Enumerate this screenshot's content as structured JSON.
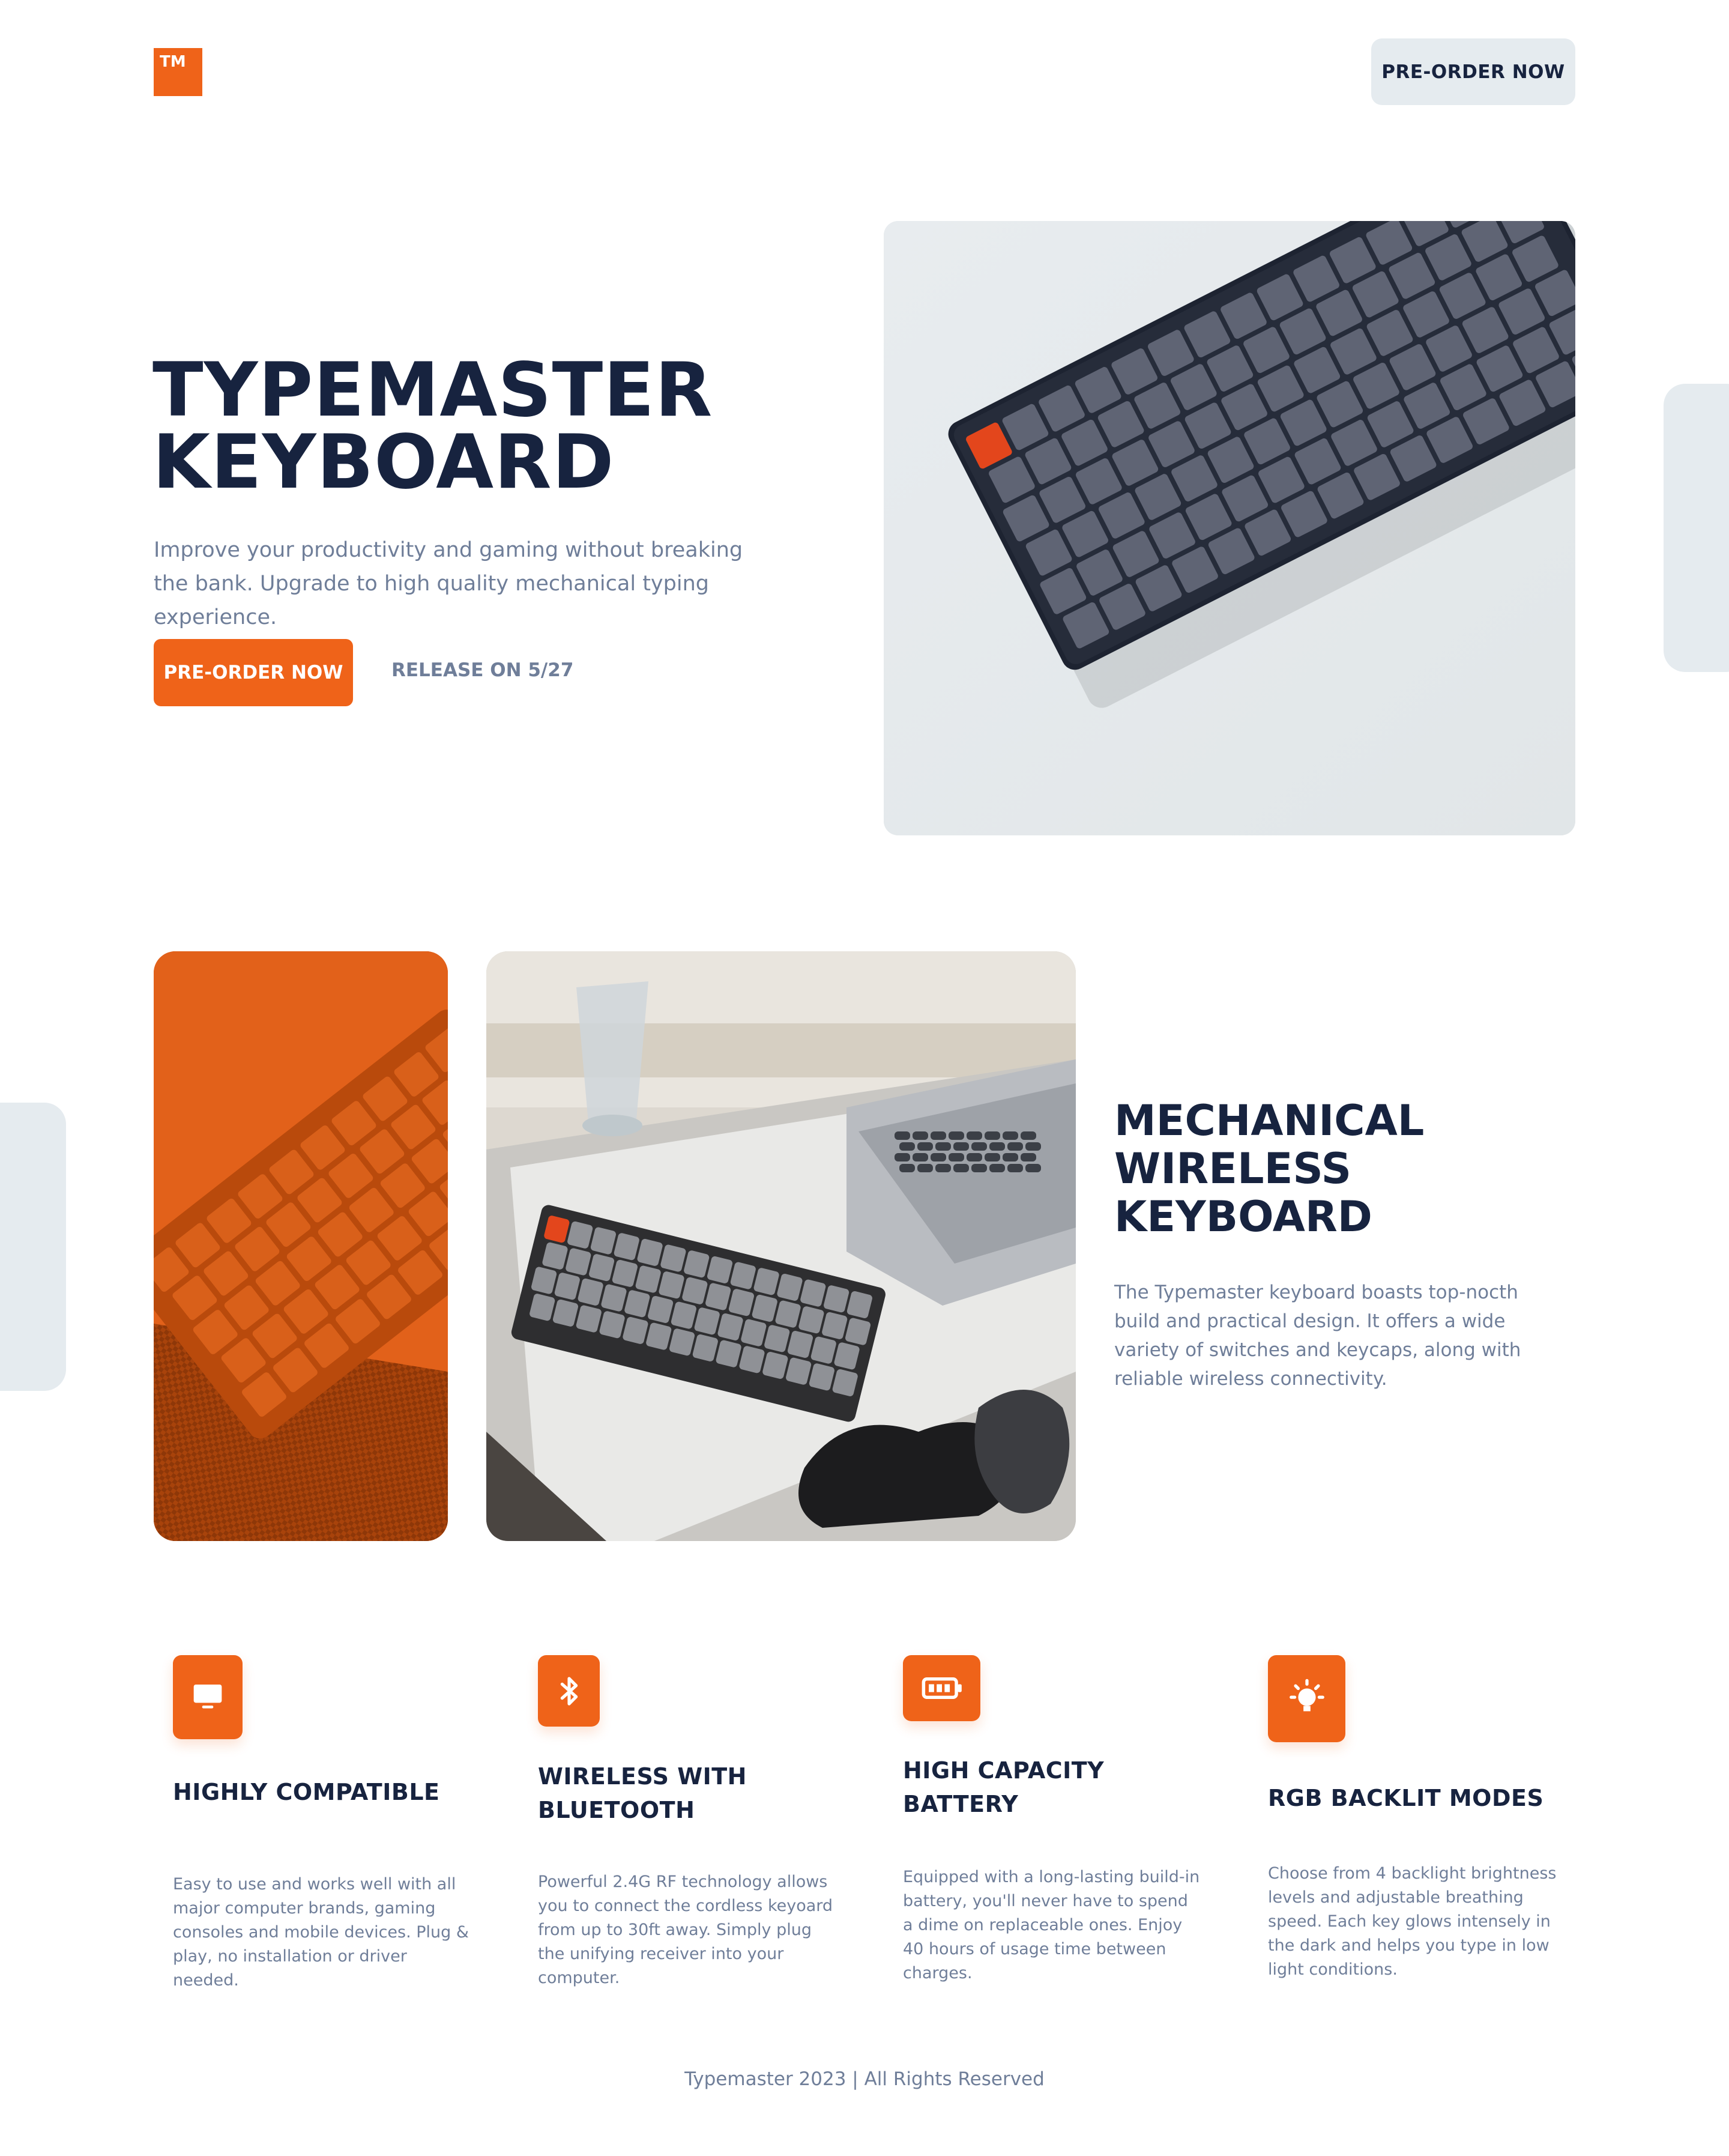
{
  "header": {
    "logo_text": "TM",
    "preorder_label": "PRE-ORDER NOW"
  },
  "hero": {
    "title_line1": "TYPEMASTER",
    "title_line2": "KEYBOARD",
    "subtitle": "Improve your productivity and gaming without breaking the bank. Upgrade to high quality mechanical typing experience.",
    "cta_label": "PRE-ORDER NOW",
    "release_text": "RELEASE ON 5/27"
  },
  "section": {
    "title_line1": "MECHANICAL",
    "title_line2": "WIRELESS",
    "title_line3": "KEYBOARD",
    "description": "The Typemaster keyboard boasts top-nocth build and practical design. It offers a wide variety of switches and keycaps, along with reliable wireless connectivity."
  },
  "features": [
    {
      "icon": "monitor-icon",
      "title": "HIGHLY COMPATIBLE",
      "text": "Easy to use and works well with all major computer brands, gaming consoles and mobile devices. Plug & play, no installation or driver needed."
    },
    {
      "icon": "bluetooth-icon",
      "title": "WIRELESS WITH BLUETOOTH",
      "text": "Powerful 2.4G RF technology allows you to connect the cordless keyoard from up to 30ft away. Simply plug the unifying receiver into your computer."
    },
    {
      "icon": "battery-icon",
      "title": "HIGH CAPACITY BATTERY",
      "text": "Equipped with a long-lasting build-in battery, you'll never have to spend a dime on replaceable ones. Enjoy 40 hours of usage time between charges."
    },
    {
      "icon": "lightbulb-icon",
      "title": "RGB BACKLIT MODES",
      "text": "Choose from 4 backlight brightness levels and adjustable breathing speed. Each key glows intensely in the dark and helps you type in low light conditions."
    }
  ],
  "footer": {
    "text": "Typemaster 2023 | All Rights Reserved"
  },
  "colors": {
    "accent": "#ef6319",
    "heading": "#17233f",
    "body_text": "#6f7e99",
    "light_panel": "#e5ebef"
  }
}
